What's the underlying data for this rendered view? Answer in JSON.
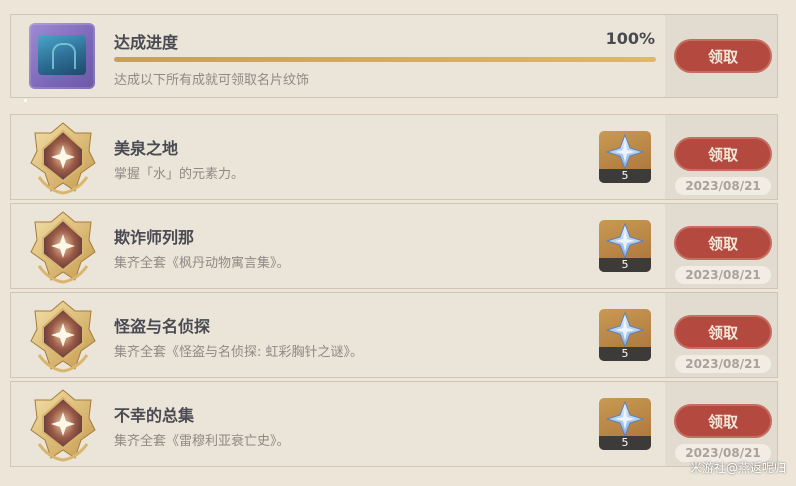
{
  "progress": {
    "title": "达成进度",
    "percent_label": "100%",
    "fraction": 1.0,
    "description": "达成以下所有成就可领取名片纹饰",
    "claim_label": "领取"
  },
  "achievements": [
    {
      "title": "美泉之地",
      "description": "掌握「水」的元素力。",
      "reward_qty": "5",
      "claim_label": "领取",
      "date": "2023/08/21"
    },
    {
      "title": "欺诈师列那",
      "description": "集齐全套《枫丹动物寓言集》。",
      "reward_qty": "5",
      "claim_label": "领取",
      "date": "2023/08/21"
    },
    {
      "title": "怪盗与名侦探",
      "description": "集齐全套《怪盗与名侦探: 虹彩胸针之谜》。",
      "reward_qty": "5",
      "claim_label": "领取",
      "date": "2023/08/21"
    },
    {
      "title": "不幸的总集",
      "description": "集齐全套《雷穆利亚衰亡史》。",
      "reward_qty": "5",
      "claim_label": "领取",
      "date": "2023/08/21"
    }
  ],
  "watermark": "米游社@燕返呢归",
  "colors": {
    "claim_button": "#b3493f",
    "progress_fill": "#e0b85d",
    "panel_bg": "#ebe4d8"
  },
  "icons": {
    "badge": "achievement-badge-icon",
    "reward": "primogem-icon",
    "namecard": "namecard-icon"
  }
}
